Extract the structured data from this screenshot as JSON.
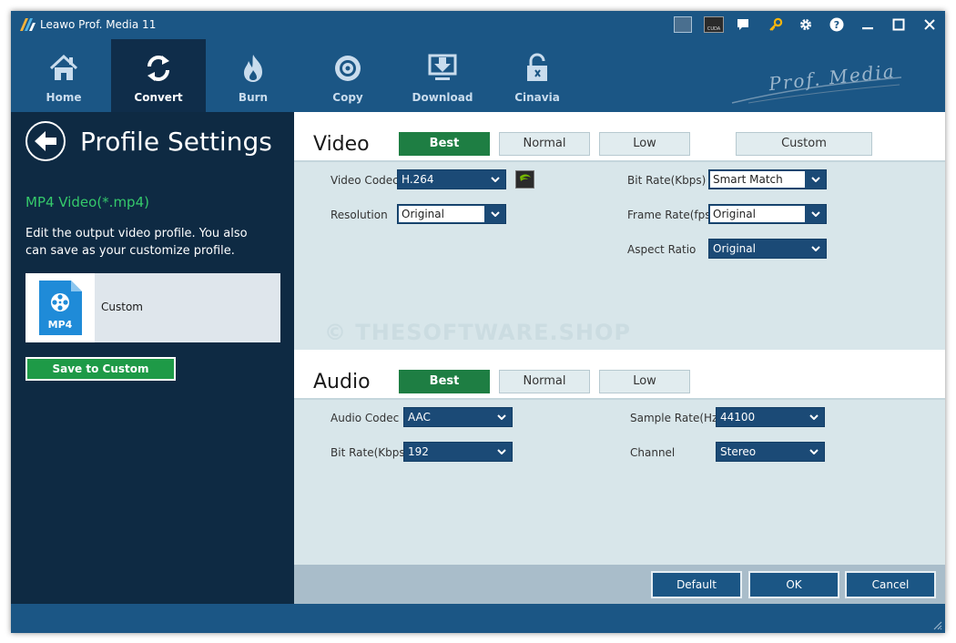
{
  "window": {
    "title": "Leawo Prof. Media 11"
  },
  "titlebar_icons": [
    "cpu-icon",
    "cuda-icon",
    "chat-icon",
    "key-icon",
    "gear-icon",
    "help-icon",
    "minimize-icon",
    "maximize-icon",
    "close-icon"
  ],
  "toolbar": {
    "items": [
      {
        "label": "Home",
        "icon": "home-icon"
      },
      {
        "label": "Convert",
        "icon": "convert-icon",
        "active": true
      },
      {
        "label": "Burn",
        "icon": "burn-icon"
      },
      {
        "label": "Copy",
        "icon": "copy-icon"
      },
      {
        "label": "Download",
        "icon": "download-icon"
      },
      {
        "label": "Cinavia",
        "icon": "cinavia-icon"
      }
    ],
    "brand": "Prof. Media"
  },
  "left": {
    "title": "Profile Settings",
    "format": "MP4 Video(*.mp4)",
    "description": "Edit the output video profile. You also can save as your customize profile.",
    "profile": {
      "badge": "MP4",
      "name": "Custom"
    },
    "save_button": "Save to Custom"
  },
  "video": {
    "title": "Video",
    "presets": [
      "Best",
      "Normal",
      "Low",
      "Custom"
    ],
    "active_preset": "Best",
    "fields": {
      "codec": {
        "label": "Video Codec",
        "value": "H.264"
      },
      "resolution": {
        "label": "Resolution",
        "value": "Original"
      },
      "bitrate": {
        "label": "Bit Rate(Kbps)",
        "value": "Smart Match"
      },
      "framerate": {
        "label": "Frame Rate(fps)",
        "value": "Original"
      },
      "aspect": {
        "label": "Aspect Ratio",
        "value": "Original"
      }
    }
  },
  "audio": {
    "title": "Audio",
    "presets": [
      "Best",
      "Normal",
      "Low"
    ],
    "active_preset": "Best",
    "fields": {
      "codec": {
        "label": "Audio Codec",
        "value": "AAC"
      },
      "bitrate": {
        "label": "Bit Rate(Kbps)",
        "value": "192"
      },
      "samplerate": {
        "label": "Sample Rate(Hz)",
        "value": "44100"
      },
      "channel": {
        "label": "Channel",
        "value": "Stereo"
      }
    }
  },
  "watermark": "© THESOFTWARE.SHOP",
  "buttons": {
    "default": "Default",
    "ok": "OK",
    "cancel": "Cancel"
  }
}
